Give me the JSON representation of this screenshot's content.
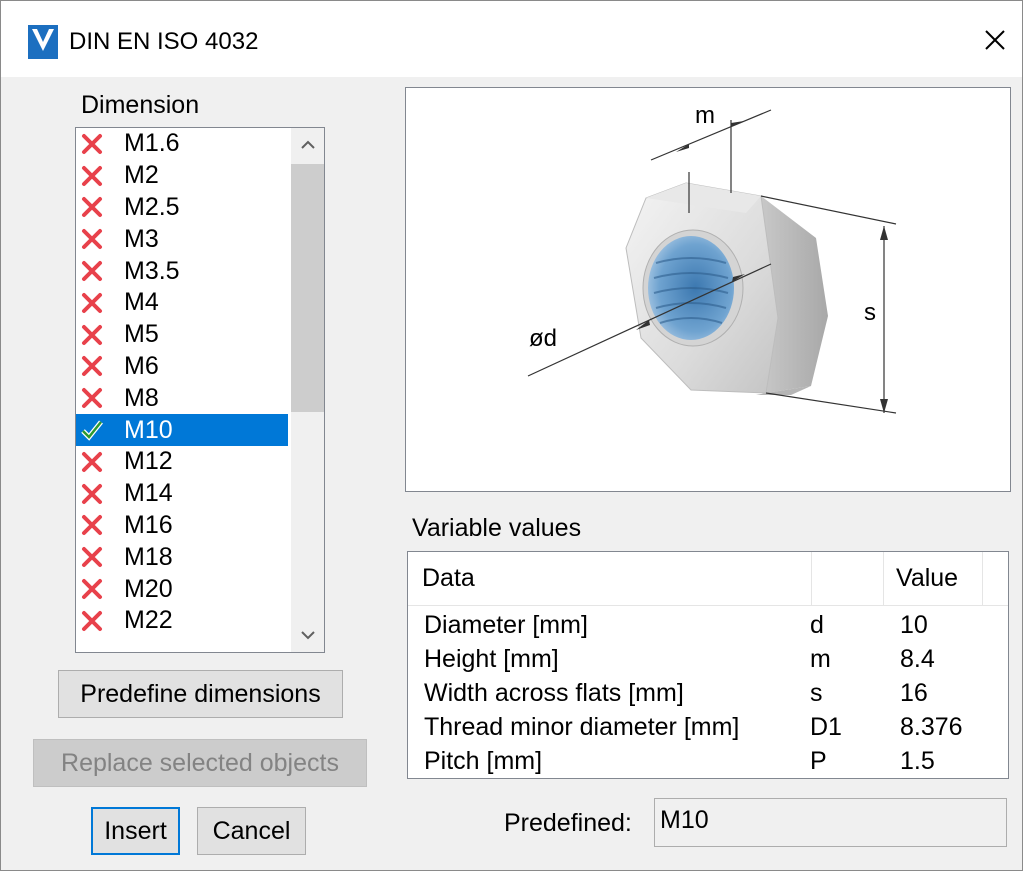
{
  "window": {
    "title": "DIN EN ISO 4032",
    "close_glyph": "✕"
  },
  "dimension": {
    "label": "Dimension",
    "items": [
      {
        "label": "M1.6",
        "status": "cross"
      },
      {
        "label": "M2",
        "status": "cross"
      },
      {
        "label": "M2.5",
        "status": "cross"
      },
      {
        "label": "M3",
        "status": "cross"
      },
      {
        "label": "M3.5",
        "status": "cross"
      },
      {
        "label": "M4",
        "status": "cross"
      },
      {
        "label": "M5",
        "status": "cross"
      },
      {
        "label": "M6",
        "status": "cross"
      },
      {
        "label": "M8",
        "status": "cross"
      },
      {
        "label": "M10",
        "status": "check",
        "selected": true
      },
      {
        "label": "M12",
        "status": "cross"
      },
      {
        "label": "M14",
        "status": "cross"
      },
      {
        "label": "M16",
        "status": "cross"
      },
      {
        "label": "M18",
        "status": "cross"
      },
      {
        "label": "M20",
        "status": "cross"
      },
      {
        "label": "M22",
        "status": "cross"
      }
    ]
  },
  "buttons": {
    "predefine": "Predefine dimensions",
    "replace": "Replace selected objects",
    "insert": "Insert",
    "cancel": "Cancel"
  },
  "diagram": {
    "label_m": "m",
    "label_s": "s",
    "label_d": "ød"
  },
  "variables": {
    "label": "Variable values",
    "columns": [
      "Data",
      "",
      "Value"
    ],
    "rows": [
      {
        "data": "Diameter [mm]",
        "sym": "d",
        "value": "10"
      },
      {
        "data": "Height [mm]",
        "sym": "m",
        "value": "8.4"
      },
      {
        "data": "Width across flats [mm]",
        "sym": "s",
        "value": "16"
      },
      {
        "data": "Thread minor diameter [mm]",
        "sym": "D1",
        "value": "8.376"
      },
      {
        "data": "Pitch [mm]",
        "sym": "P",
        "value": "1.5"
      }
    ]
  },
  "predefined": {
    "label": "Predefined:",
    "value": "M10"
  },
  "colors": {
    "selection": "#0078d7",
    "cross": "#e8414b",
    "check": "#2e9a2e",
    "default_button_border": "#0078d7"
  }
}
